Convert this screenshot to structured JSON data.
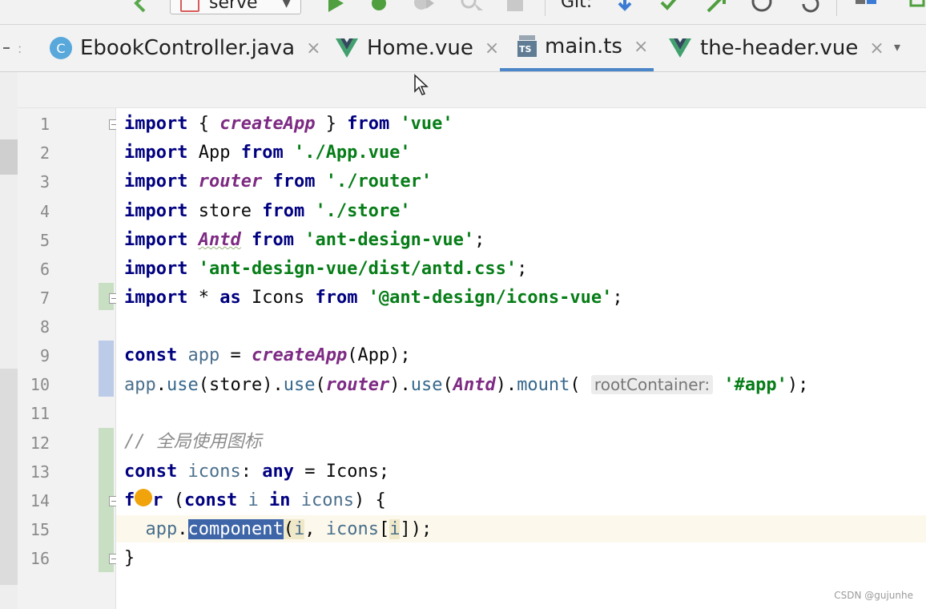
{
  "toolbar": {
    "run_config_label": "serve",
    "git_label": "Git:"
  },
  "tabs": [
    {
      "label": "EbookController.java",
      "icon": "java-class-icon",
      "icon_letter": "C",
      "active": false
    },
    {
      "label": "Home.vue",
      "icon": "vue-file-icon",
      "active": false
    },
    {
      "label": "main.ts",
      "icon": "typescript-file-icon",
      "icon_badge": "TS",
      "active": true
    },
    {
      "label": "the-header.vue",
      "icon": "vue-file-icon",
      "active": false
    }
  ],
  "tab_close_glyph": "×",
  "line_numbers": [
    "1",
    "2",
    "3",
    "4",
    "5",
    "6",
    "7",
    "8",
    "9",
    "10",
    "11",
    "12",
    "13",
    "14",
    "15",
    "16"
  ],
  "code": {
    "l1": {
      "kw1": "import",
      "t1": " { ",
      "fn": "createApp",
      "t2": " } ",
      "kw2": "from",
      "sp": " ",
      "str": "'vue'"
    },
    "l2": {
      "kw1": "import",
      "t1": " App ",
      "kw2": "from",
      "sp": " ",
      "str": "'./App.vue'"
    },
    "l3": {
      "kw1": "import",
      "sp1": " ",
      "id": "router",
      "sp2": " ",
      "kw2": "from",
      "sp3": " ",
      "str": "'./router'"
    },
    "l4": {
      "kw1": "import",
      "t1": " store ",
      "kw2": "from",
      "sp": " ",
      "str": "'./store'"
    },
    "l5": {
      "kw1": "import",
      "sp1": " ",
      "id": "Antd",
      "sp2": " ",
      "kw2": "from",
      "sp3": " ",
      "str": "'ant-design-vue'",
      "end": ";"
    },
    "l6": {
      "kw1": "import",
      "sp": " ",
      "str": "'ant-design-vue/dist/antd.css'",
      "end": ";"
    },
    "l7": {
      "kw1": "import",
      "t1": " * ",
      "kw2": "as",
      "t2": " Icons ",
      "kw3": "from",
      "sp": " ",
      "str": "'@ant-design/icons-vue'",
      "end": ";"
    },
    "l9": {
      "kw1": "const",
      "sp": " ",
      "var": "app",
      "t1": " = ",
      "fn": "createApp",
      "t2": "(App);"
    },
    "l10": {
      "var": "app",
      "d1": ".",
      "m1": "use",
      "t1": "(store).",
      "m2": "use",
      "t2": "(",
      "id1": "router",
      "t3": ").",
      "m3": "use",
      "t4": "(",
      "id2": "Antd",
      "t5": ").",
      "m4": "mount",
      "t6": "( ",
      "hint": "rootContainer:",
      "sp": " ",
      "str": "'#app'",
      "end": ");"
    },
    "l12": {
      "comment": "// 全局使用图标"
    },
    "l13": {
      "kw1": "const",
      "sp1": " ",
      "var": "icons",
      "t1": ": ",
      "kw2": "any",
      "t2": " = Icons;"
    },
    "l14": {
      "kw1a": "f",
      "kw1b": "r",
      "t1": " (",
      "kw2": "const",
      "sp1": " ",
      "var1": "i",
      "sp2": " ",
      "kw3": "in",
      "sp3": " ",
      "var2": "icons",
      "t2": ") {"
    },
    "l15": {
      "indent": "  ",
      "var": "app",
      "d": ".",
      "sel": "component",
      "t1": "(",
      "v1": "i",
      "t2": ", ",
      "v2": "icons",
      "t3": "[",
      "v3": "i",
      "t4": "]);"
    },
    "l16": {
      "t": "}"
    }
  },
  "watermark": "CSDN @gujunhe"
}
